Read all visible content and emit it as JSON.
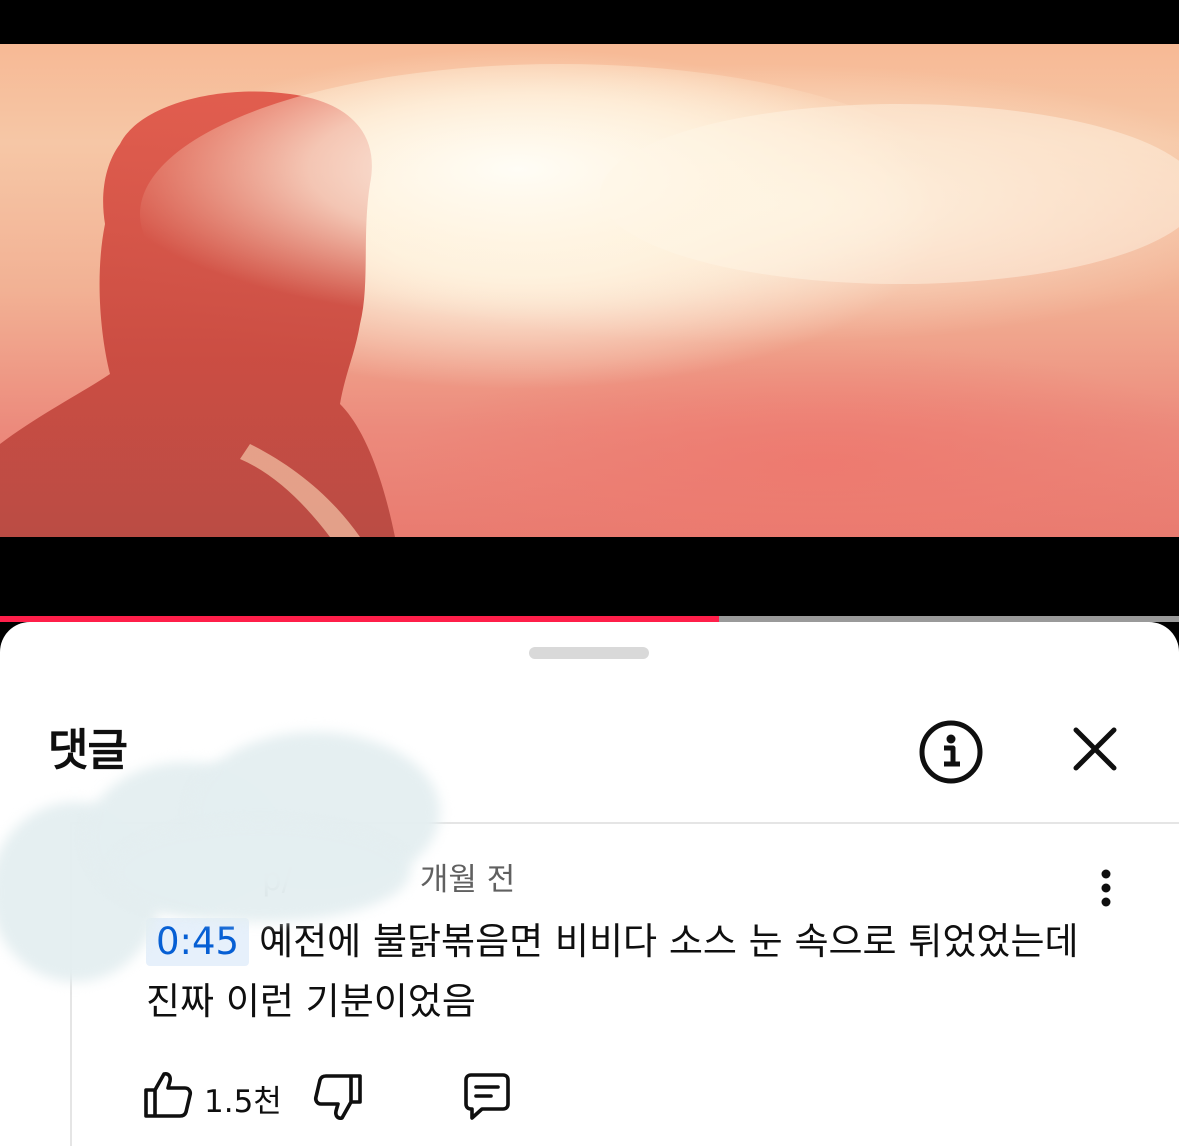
{
  "video": {
    "progress_fraction": 0.61,
    "progress_color": "#ff1f4a"
  },
  "comments_panel": {
    "title": "댓글",
    "info_icon": "info-icon",
    "close_icon": "close-icon"
  },
  "comment": {
    "author_fragment": "p/",
    "time_ago": "개월 전",
    "timestamp_link": "0:45",
    "body": "예전에 불닭볶음면 비비다 소스 눈 속으로 튀었었는데 진짜 이런 기분이었음",
    "like_count": "1.5천",
    "more_icon": "more-vert-icon",
    "like_icon": "thumbs-up-icon",
    "dislike_icon": "thumbs-down-icon",
    "reply_icon": "reply-comment-icon"
  },
  "colors": {
    "link_blue": "#065fd4",
    "text_primary": "#0f0f0f",
    "text_secondary": "#606060"
  }
}
